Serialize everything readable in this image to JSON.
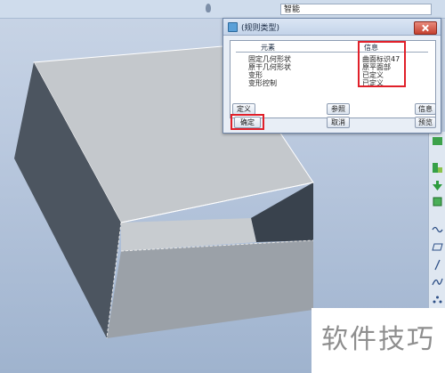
{
  "topbar": {
    "search_value": "智能"
  },
  "dialog": {
    "title": "(规则类型)",
    "columns": {
      "element": "元素",
      "info": "信息"
    },
    "rows": [
      {
        "name": "固定几何形状",
        "info": "曲面标识47"
      },
      {
        "name": "原干几何形状",
        "info": "原平面部"
      },
      {
        "name": "变形",
        "info": "已定义"
      },
      {
        "name": "变形控制",
        "info": "已定义"
      }
    ],
    "buttons": {
      "define": "定义",
      "reference": "参照",
      "info": "信息",
      "ok": "确定",
      "cancel": "取消",
      "preview": "预览"
    }
  },
  "watermark": "软件技巧",
  "colors": {
    "highlight": "#e0202a",
    "model_top": "#c4c8cc",
    "model_side": "#4c5560"
  }
}
